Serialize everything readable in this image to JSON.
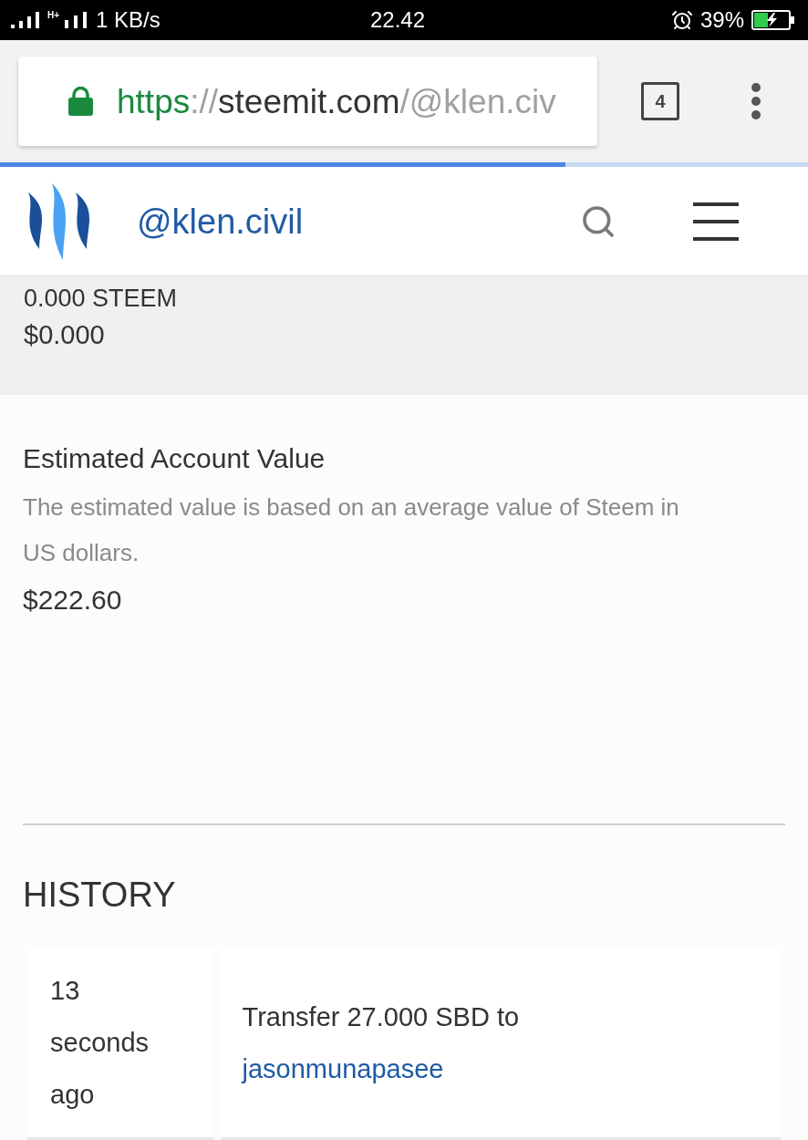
{
  "status_bar": {
    "network": "H+",
    "speed": "1 KB/s",
    "time": "22.42",
    "battery": "39%"
  },
  "browser": {
    "url": {
      "scheme": "https",
      "separator": "://",
      "host": "steemit.com",
      "path": "/@klen.civ"
    },
    "tab_count": "4",
    "loading": {
      "level": 0.7
    }
  },
  "header": {
    "username": "@klen.civil"
  },
  "balance": {
    "amount": "0.000 STEEM",
    "usd": "$0.000"
  },
  "estimated_value": {
    "title": "Estimated Account Value",
    "description": "The estimated value is based on an average value of Steem in US dollars.",
    "value": "$222.60"
  },
  "history": {
    "title": "HISTORY",
    "rows": [
      {
        "time": "13 seconds ago",
        "description": "Transfer 27.000 SBD to",
        "link": "jasonmunapasee"
      }
    ]
  }
}
